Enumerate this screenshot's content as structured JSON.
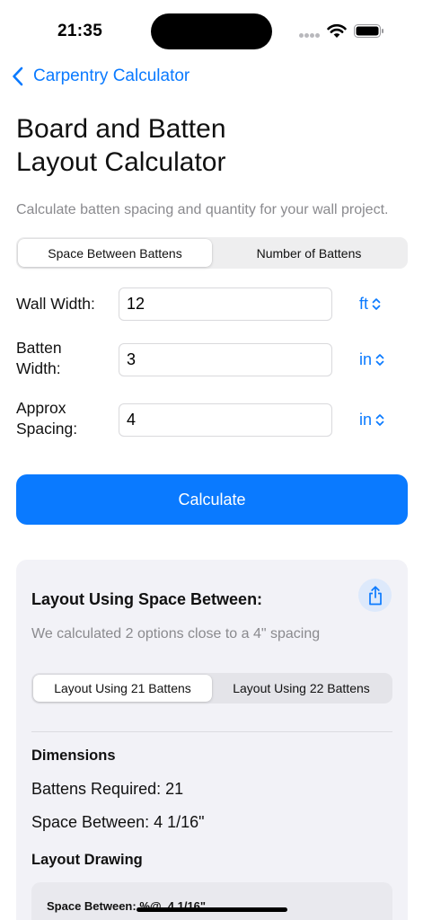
{
  "status_bar": {
    "time": "21:35"
  },
  "nav": {
    "back_label": "Carpentry Calculator"
  },
  "page": {
    "title_line1": "Board and Batten",
    "title_line2": "Layout Calculator"
  },
  "intro": "Calculate batten spacing and quantity for your wall project.",
  "mode": {
    "options": [
      "Space Between Battens",
      "Number of Battens"
    ],
    "selected": "Space Between Battens"
  },
  "form": {
    "wall_width": {
      "label": "Wall Width:",
      "value": "12",
      "unit": "ft"
    },
    "batten_width": {
      "label_line1": "Batten",
      "label_line2": "Width:",
      "value": "3",
      "unit": "in"
    },
    "approx_spacing": {
      "label_line1": "Approx",
      "label_line2": "Spacing:",
      "value": "4",
      "unit": "in"
    }
  },
  "calculate_label": "Calculate",
  "results": {
    "title": "Layout Using Space Between:",
    "subtitle": "We calculated 2 options close to a 4\" spacing",
    "options": [
      "Layout Using 21 Battens",
      "Layout Using 22 Battens"
    ],
    "selected": "Layout Using 21 Battens",
    "dimensions_heading": "Dimensions",
    "battens_required": "Battens Required: 21",
    "space_between": "Space Between: 4 1/16\"",
    "layout_drawing_heading": "Layout Drawing",
    "drawing_label": "Space Between: %@, 4 1/16\""
  },
  "colors": {
    "accent": "#0a7aff",
    "secondary_text": "#8a8a8e",
    "card_background": "#f2f2f7",
    "segment_background": "#eeeeef"
  },
  "icons": {
    "back": "chevron-left-icon",
    "unit": "chevron-up-down-icon",
    "share": "share-icon",
    "wifi": "wifi-icon",
    "battery": "battery-icon",
    "signal": "cellular-signal-icon"
  }
}
